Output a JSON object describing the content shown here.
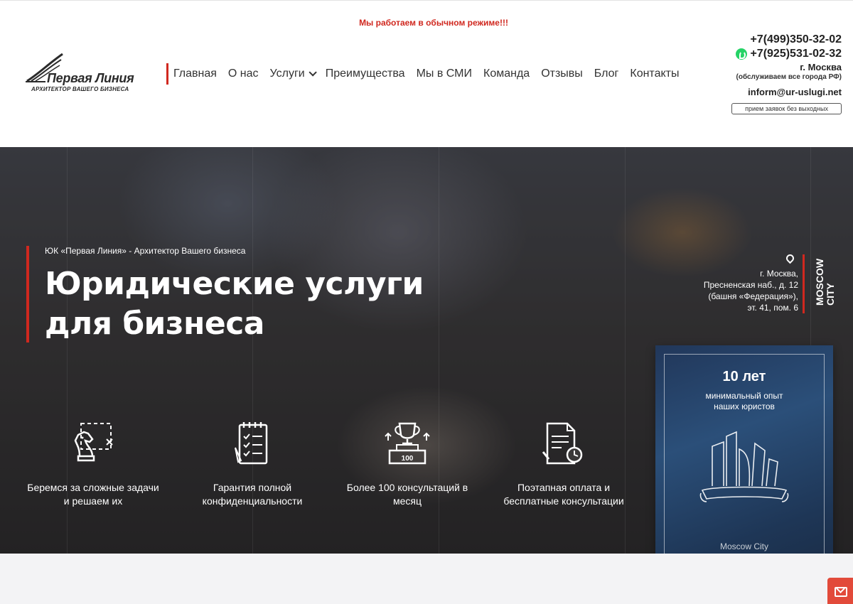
{
  "notice": "Мы работаем в обычном режиме!!!",
  "logo": {
    "title": "Первая Линия",
    "subtitle": "АРХИТЕКТОР ВАШЕГО БИЗНЕСА"
  },
  "nav": {
    "items": [
      {
        "label": "Главная"
      },
      {
        "label": "О нас"
      },
      {
        "label": "Услуги",
        "dropdown": true
      },
      {
        "label": "Преимущества"
      },
      {
        "label": "Мы в СМИ"
      },
      {
        "label": "Команда"
      },
      {
        "label": "Отзывы"
      },
      {
        "label": "Блог"
      },
      {
        "label": "Контакты"
      }
    ]
  },
  "contacts": {
    "phone1": "+7(499)350-32-02",
    "phone2": "+7(925)531-02-32",
    "city": "г. Москва",
    "all_cities": "(обслуживаем все города РФ)",
    "email": "inform@ur-uslugi.net",
    "hours": "прием заявок без выходных"
  },
  "hero": {
    "kicker": "ЮК «Первая Линия» - Архитектор Вашего бизнеса",
    "title_line1": "Юридические услуги",
    "title_line2": "для бизнеса",
    "address_line1": "г. Москва,",
    "address_line2": "Пресненская наб., д. 12",
    "address_line3": "(башня «Федерация»),",
    "address_line4": "эт. 41, пом. 6",
    "moscow_city_line1": "MOSCOW",
    "moscow_city_line2": "CITY"
  },
  "features": [
    {
      "icon": "chess-knight-icon",
      "line1": "Беремся за сложные задачи",
      "line2": "и решаем их"
    },
    {
      "icon": "checklist-icon",
      "line1": "Гарантия полной",
      "line2": "конфиденциальности"
    },
    {
      "icon": "trophy-icon",
      "badge": "100",
      "line1": "Более 100 консультаций в",
      "line2": "месяц"
    },
    {
      "icon": "document-clock-icon",
      "line1": "Поэтапная оплата и",
      "line2": "бесплатные консультации"
    }
  ],
  "card": {
    "years": "10 лет",
    "desc_line1": "минимальный опыт",
    "desc_line2": "наших юристов",
    "city": "Moscow City"
  },
  "colors": {
    "accent": "#d0281f",
    "card": "#243e63",
    "mail_button": "#e24a3a"
  }
}
